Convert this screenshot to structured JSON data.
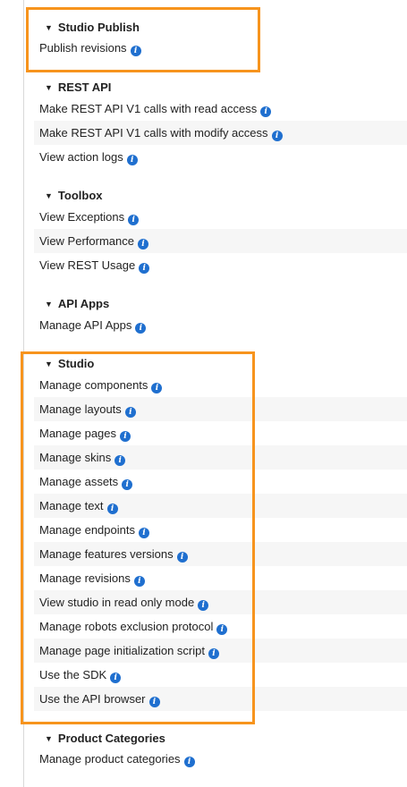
{
  "sections": [
    {
      "title": "Studio Publish",
      "items": [
        "Publish revisions"
      ]
    },
    {
      "title": "REST API",
      "items": [
        "Make REST API V1 calls with read access",
        "Make REST API V1 calls with modify access",
        "View action logs"
      ]
    },
    {
      "title": "Toolbox",
      "items": [
        "View Exceptions",
        "View Performance",
        "View REST Usage"
      ]
    },
    {
      "title": "API Apps",
      "items": [
        "Manage API Apps"
      ]
    },
    {
      "title": "Studio",
      "items": [
        "Manage components",
        "Manage layouts",
        "Manage pages",
        "Manage skins",
        "Manage assets",
        "Manage text",
        "Manage endpoints",
        "Manage features versions",
        "Manage revisions",
        "View studio in read only mode",
        "Manage robots exclusion protocol",
        "Manage page initialization script",
        "Use the SDK",
        "Use the API browser"
      ]
    },
    {
      "title": "Product Categories",
      "items": [
        "Manage product categories"
      ]
    }
  ],
  "icons": {
    "collapse": "triangle-down-icon",
    "info": "info-icon"
  },
  "colors": {
    "highlight": "#f7941d",
    "info": "#1f6fcf",
    "stripe": "#f6f6f6"
  }
}
